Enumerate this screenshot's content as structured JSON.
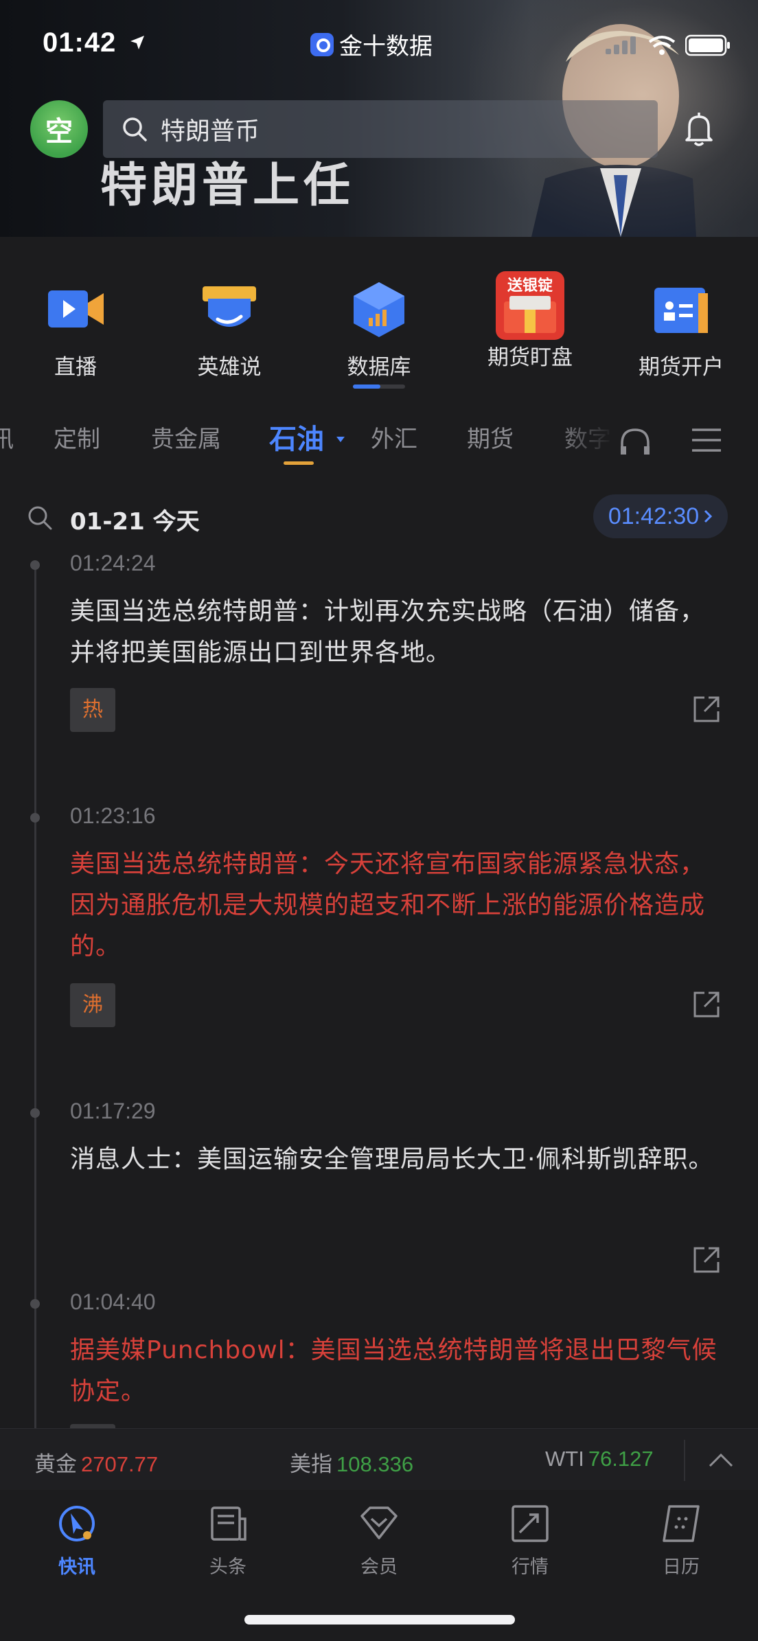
{
  "status": {
    "time": "01:42",
    "app_name": "金十数据"
  },
  "header": {
    "avatar_text": "空",
    "search_text": "特朗普币",
    "banner_title": "特朗普上任"
  },
  "quick_links": [
    {
      "label": "直播",
      "icon": "video-icon"
    },
    {
      "label": "英雄说",
      "icon": "hero-mask-icon"
    },
    {
      "label": "数据库",
      "icon": "database-cube-icon"
    },
    {
      "label": "期货盯盘",
      "icon": "gift-promo-icon",
      "promo_text": "送银锭"
    },
    {
      "label": "期货开户",
      "icon": "account-card-icon"
    }
  ],
  "tabs": {
    "items": [
      "定制",
      "贵金属",
      "石油",
      "外汇",
      "期货",
      "数字"
    ],
    "active": "石油",
    "partial_left": "讯"
  },
  "date_row": {
    "date": "01-21 今天",
    "clock": "01:42:30"
  },
  "feed": [
    {
      "time": "01:24:24",
      "text": "美国当选总统特朗普：计划再次充实战略（石油）储备，并将把美国能源出口到世界各地。",
      "important": false,
      "tag": "热"
    },
    {
      "time": "01:23:16",
      "text": "美国当选总统特朗普：今天还将宣布国家能源紧急状态，因为通胀危机是大规模的超支和不断上涨的能源价格造成的。",
      "important": true,
      "tag": "沸"
    },
    {
      "time": "01:17:29",
      "text": "消息人士：美国运输安全管理局局长大卫·佩科斯凯辞职。",
      "important": false,
      "tag": ""
    },
    {
      "time": "01:04:40",
      "text": "据美媒Punchbowl：美国当选总统特朗普将退出巴黎气候协定。",
      "important": true,
      "tag": ""
    }
  ],
  "ticker": [
    {
      "name": "黄金",
      "value": "2707.77",
      "trend": "up"
    },
    {
      "name": "美指",
      "value": "108.336",
      "trend": "down"
    },
    {
      "name": "WTI",
      "value": "76.127",
      "trend": "down"
    }
  ],
  "bottom_nav": [
    {
      "label": "快讯",
      "icon": "flash-news-icon",
      "active": true
    },
    {
      "label": "头条",
      "icon": "headline-icon",
      "active": false
    },
    {
      "label": "会员",
      "icon": "vip-diamond-icon",
      "active": false
    },
    {
      "label": "行情",
      "icon": "market-trend-icon",
      "active": false
    },
    {
      "label": "日历",
      "icon": "calendar-icon",
      "active": false
    }
  ],
  "colors": {
    "accent": "#4d86ff",
    "important_text": "#d8413a",
    "up": "#d8413a",
    "down": "#3fa046",
    "tab_underline": "#e3a23a",
    "background": "#1c1c1e"
  }
}
